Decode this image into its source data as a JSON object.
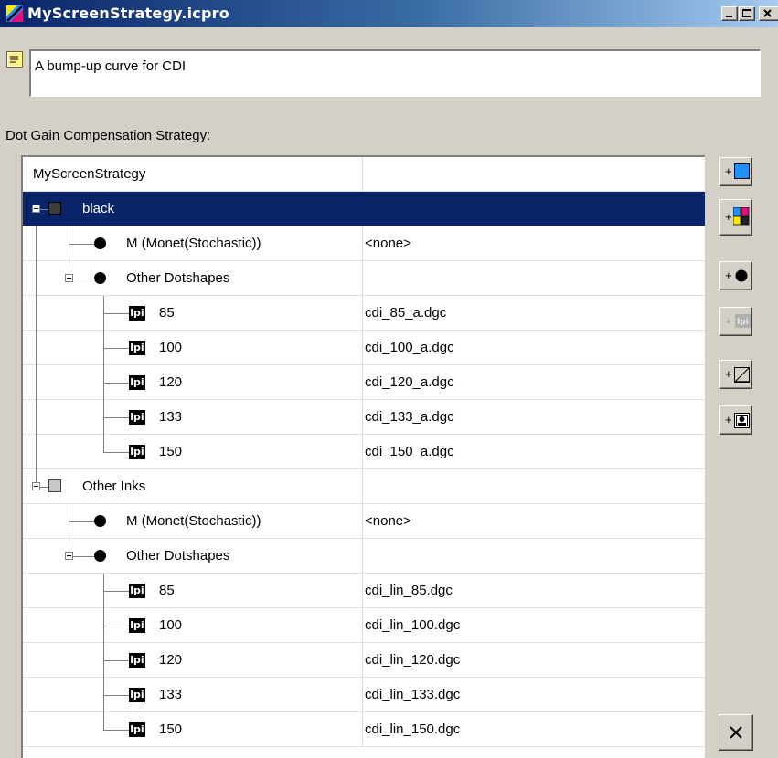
{
  "window": {
    "title": "MyScreenStrategy.icpro",
    "controls": {
      "minimize": "minimize-icon",
      "maximize": "maximize-icon",
      "close": "close-icon"
    }
  },
  "description": {
    "icon": "note-icon",
    "text": "A bump-up curve for CDI"
  },
  "strategy": {
    "label": "Dot Gain Compensation Strategy:",
    "root": "MyScreenStrategy",
    "rows": [
      {
        "name": "black",
        "value": "",
        "icon": "black-square-icon"
      },
      {
        "name": "M (Monet(Stochastic))",
        "value": "<none>",
        "icon": "dot-icon"
      },
      {
        "name": "Other Dotshapes",
        "value": "",
        "icon": "dot-icon"
      },
      {
        "name": "85",
        "value": "cdi_85_a.dgc",
        "icon": "lpi-icon"
      },
      {
        "name": "100",
        "value": "cdi_100_a.dgc",
        "icon": "lpi-icon"
      },
      {
        "name": "120",
        "value": "cdi_120_a.dgc",
        "icon": "lpi-icon"
      },
      {
        "name": "133",
        "value": "cdi_133_a.dgc",
        "icon": "lpi-icon"
      },
      {
        "name": "150",
        "value": "cdi_150_a.dgc",
        "icon": "lpi-icon"
      },
      {
        "name": "Other Inks",
        "value": "",
        "icon": "gray-square-icon"
      },
      {
        "name": "M (Monet(Stochastic))",
        "value": "<none>",
        "icon": "dot-icon"
      },
      {
        "name": "Other Dotshapes",
        "value": "",
        "icon": "dot-icon"
      },
      {
        "name": "85",
        "value": "cdi_lin_85.dgc",
        "icon": "lpi-icon"
      },
      {
        "name": "100",
        "value": "cdi_lin_100.dgc",
        "icon": "lpi-icon"
      },
      {
        "name": "120",
        "value": "cdi_lin_120.dgc",
        "icon": "lpi-icon"
      },
      {
        "name": "133",
        "value": "cdi_lin_133.dgc",
        "icon": "lpi-icon"
      },
      {
        "name": "150",
        "value": "cdi_lin_150.dgc",
        "icon": "lpi-icon"
      }
    ],
    "lpi_glyph": "lpi",
    "selected_row": "black"
  },
  "toolbar": {
    "plus": "+",
    "buttons": [
      {
        "icon": "add-ink-icon",
        "enabled": true
      },
      {
        "icon": "add-ink-group-icon",
        "enabled": true
      },
      {
        "icon": "add-dotshape-icon",
        "enabled": true
      },
      {
        "icon": "add-lpi-icon",
        "enabled": false
      },
      {
        "icon": "add-curve-icon",
        "enabled": true
      },
      {
        "icon": "add-screen-icon",
        "enabled": true
      }
    ],
    "delete_icon": "delete-x-icon"
  },
  "colors": {
    "selection": "#0a246a",
    "cyan": "#1e90ff",
    "magenta": "#e0107a",
    "yellow": "#ffe800"
  }
}
